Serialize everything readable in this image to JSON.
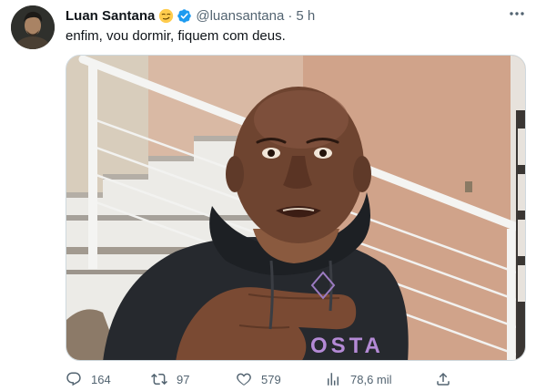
{
  "tweet": {
    "author_name": "Luan Santana",
    "handle": "@luansantana",
    "separator": "·",
    "time": "5 h",
    "text": "enfim, vou dormir, fiquem com deus.",
    "icons": {
      "emoji": "smirking-face-emoji",
      "verified": "verified-badge-icon",
      "more": "more-options-icon"
    },
    "colors": {
      "verified": "#1d9bf0",
      "muted": "#536471",
      "text": "#0f1419"
    }
  },
  "actions": {
    "replies": {
      "icon": "reply-icon",
      "count": "164"
    },
    "retweets": {
      "icon": "retweet-icon",
      "count": "97"
    },
    "likes": {
      "icon": "like-icon",
      "count": "579"
    },
    "views": {
      "icon": "views-icon",
      "count": "78,6 mil"
    },
    "share": {
      "icon": "share-icon"
    }
  },
  "media": {
    "hoodie_text": "OSTA"
  }
}
